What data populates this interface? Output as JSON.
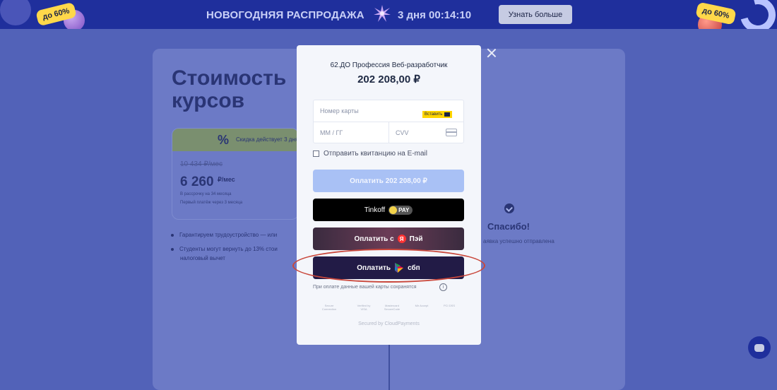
{
  "banner": {
    "discount_left": "до 60%",
    "title": "НОВОГОДНЯЯ РАСПРОДАЖА",
    "timer": "3 дня 00:14:10",
    "cta": "Узнать больше",
    "discount_right": "до 60%"
  },
  "page": {
    "title": "Стоимость курсов",
    "discount_strip": "Скидка действует 3 дня",
    "percent_sign": "%",
    "old_price": "10 434 ₽/мес",
    "new_price": "6 260",
    "new_price_suffix": "₽/мес",
    "installment": "В рассрочку на 34 месяца",
    "first_payment": "Первый платёж через 3 месяца",
    "bullet_1": "Гарантируем трудоустройство — или",
    "bullet_2": "Студенты могут вернуть до 13% стои",
    "bullet_2b": "налоговый вычет",
    "thanks_title": "Спасибо!",
    "thanks_sub": "аявка успешно отправлена"
  },
  "modal": {
    "product_title": "62.ДО Профессия Веб-разработчик",
    "amount": "202 208,00 ₽",
    "card_number_placeholder": "Номер карты",
    "paste_label": "Вставить",
    "expiry_placeholder": "ММ / ГГ",
    "cvv_placeholder": "CVV",
    "email_receipt_label": "Отправить квитанцию на E-mail",
    "pay_button": "Оплатить 202 208,00 ₽",
    "tinkoff_label": "Tinkoff",
    "tinkoff_pay": "PAY",
    "yandex_label": "Оплатить с",
    "yandex_brand": "Пэй",
    "yandex_letter": "Я",
    "sbp_label": "Оплатить",
    "sbp_brand": "сбп",
    "notice": "При оплате данные вашей карты сохранятся",
    "info_glyph": "i",
    "secured": "Secured by CloudPayments",
    "security_logos": [
      "Secure Connection",
      "Verified by VISA",
      "Mastercard SecureCode",
      "Mir Accept",
      "PCI DSS"
    ]
  },
  "colors": {
    "page_bg": "#5262b8",
    "banner_bg": "#1f2f9c",
    "accent_yellow": "#ffd84a",
    "highlight": "#c9473b",
    "primary_pay": "#a9c1f5"
  }
}
